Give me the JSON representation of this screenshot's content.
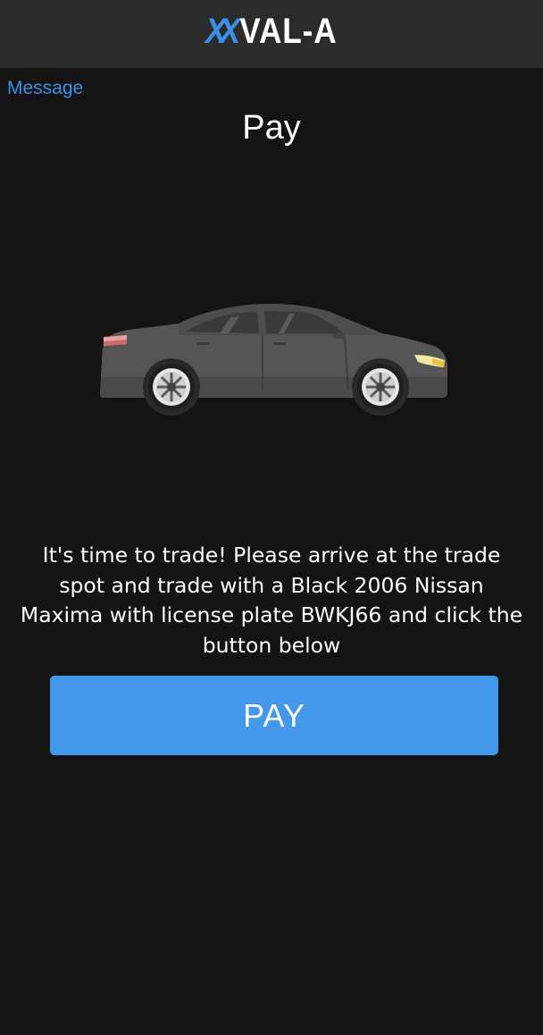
{
  "header": {
    "logo_mark": "XX",
    "logo_text": "VAL-A",
    "brand_color": "#3a8fe8"
  },
  "nav": {
    "message_link": "Message"
  },
  "page": {
    "title": "Pay",
    "illustration": "car-icon",
    "instructions": "It's time to trade! Please arrive at the trade spot and trade with a Black 2006 Nissan Maxima with license plate BWKJ66 and click the button below"
  },
  "actions": {
    "pay_label": "PAY",
    "pay_color": "#4398ec"
  },
  "theme": {
    "background": "#141414",
    "topbar": "#2b2b2b"
  }
}
